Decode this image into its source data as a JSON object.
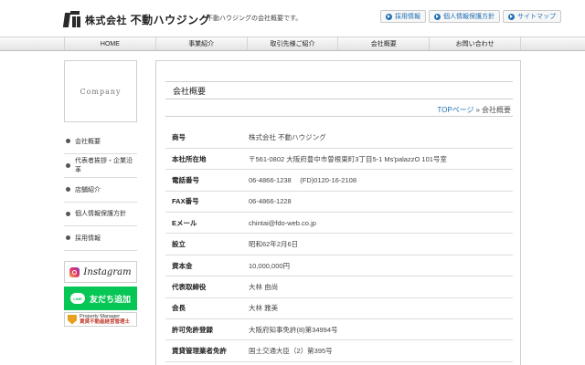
{
  "header": {
    "logo_prefix": "株式会社",
    "logo_name": "不動ハウジング",
    "tagline": "不動ハウジングの会社概要です。",
    "top_links": [
      "採用情報",
      "個人情報保護方針",
      "サイトマップ"
    ]
  },
  "nav": [
    "HOME",
    "事業紹介",
    "取引先様ご紹介",
    "会社概要",
    "お問い合わせ"
  ],
  "sidebar": {
    "heading": "Company",
    "items": [
      "会社概要",
      "代表者挨拶・企業沿革",
      "店舗紹介",
      "個人情報保護方針",
      "採用情報"
    ],
    "banners": {
      "instagram": "Instagram",
      "line_icon": "LINE",
      "line": "友だち追加",
      "shield_top": "Property Manager",
      "shield": "賃貸不動産経営管理士"
    }
  },
  "main": {
    "title": "会社概要",
    "breadcrumb": {
      "home": "TOPページ",
      "sep": "»",
      "current": "会社概要"
    },
    "rows": [
      {
        "label": "商号",
        "value": "株式会社 不動ハウジング"
      },
      {
        "label": "本社所在地",
        "value": "〒561-0802 大阪府豊中市曽根東町3丁目5-1 Ms'palazzO 101号室"
      },
      {
        "label": "電話番号",
        "value": "06-4866-1238　 (FD)0120-16-2108"
      },
      {
        "label": "FAX番号",
        "value": "06-4866-1228"
      },
      {
        "label": "Eメール",
        "value": "chintai@fdo-web.co.jp"
      },
      {
        "label": "設立",
        "value": "昭和62年2月6日"
      },
      {
        "label": "資本金",
        "value": "10,000,000円"
      },
      {
        "label": "代表取締役",
        "value": "大林 由尚"
      },
      {
        "label": "会長",
        "value": "大林 雅美"
      },
      {
        "label": "許可免許登録",
        "value": "大阪府知事免許(8)第34994号"
      },
      {
        "label": "賃貸管理業者免許",
        "value": "国土交通大臣（2）第395号"
      }
    ]
  }
}
